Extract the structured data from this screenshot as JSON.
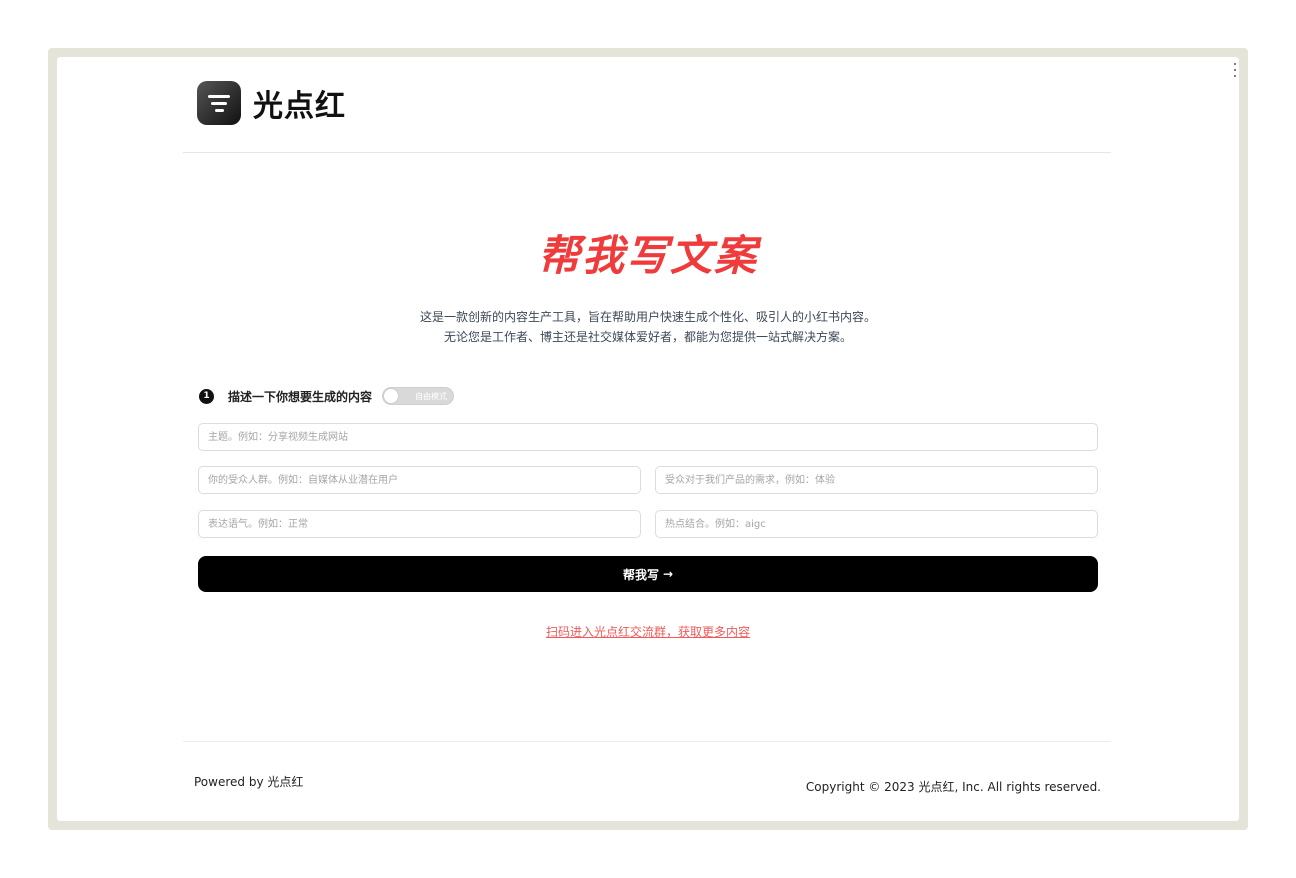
{
  "brand": {
    "name": "光点红"
  },
  "hero": {
    "title": "帮我写文案",
    "desc_line1": "这是一款创新的内容生产工具，旨在帮助用户快速生成个性化、吸引人的小红书内容。",
    "desc_line2": "无论您是工作者、博主还是社交媒体爱好者，都能为您提供一站式解决方案。"
  },
  "form": {
    "step_number": "1",
    "step_label": "描述一下你想要生成的内容",
    "toggle_label": "自由模式",
    "fields": {
      "topic_placeholder": "主题。例如：分享视频生成网站",
      "audience_placeholder": "你的受众人群。例如：自媒体从业潜在用户",
      "need_placeholder": "受众对于我们产品的需求，例如：体验",
      "tone_placeholder": "表达语气。例如：正常",
      "hotspot_placeholder": "热点结合。例如：aigc"
    },
    "submit_label": "帮我写",
    "submit_arrow": "→"
  },
  "community_link": "扫码进入光点红交流群，获取更多内容",
  "footer": {
    "powered_by": "Powered by 光点红",
    "copyright": "Copyright © 2023 光点红, Inc. All rights reserved."
  },
  "colors": {
    "accent": "#ef3b3b",
    "link": "#ef5b5b",
    "button": "#000000"
  }
}
